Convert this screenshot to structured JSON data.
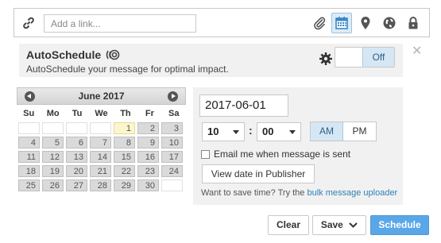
{
  "link_bar": {
    "placeholder": "Add a link..."
  },
  "autoschedule": {
    "title": "AutoSchedule",
    "description": "AutoSchedule your message for optimal impact.",
    "toggle_label": "Off"
  },
  "calendar": {
    "month_label": "June 2017",
    "weekdays": [
      "Su",
      "Mo",
      "Tu",
      "We",
      "Th",
      "Fr",
      "Sa"
    ],
    "days": [
      "",
      "",
      "",
      "",
      "1",
      "2",
      "3",
      "4",
      "5",
      "6",
      "7",
      "8",
      "9",
      "10",
      "11",
      "12",
      "13",
      "14",
      "15",
      "16",
      "17",
      "18",
      "19",
      "20",
      "21",
      "22",
      "23",
      "24",
      "25",
      "26",
      "27",
      "28",
      "29",
      "30",
      ""
    ],
    "today": "1",
    "selectable_days": []
  },
  "schedule": {
    "date": "2017-06-01",
    "hour": "10",
    "minute": "00",
    "colon": ":",
    "am_label": "AM",
    "pm_label": "PM",
    "email_label": "Email me when message is sent",
    "view_date_label": "View date in Publisher",
    "save_time_text": "Want to save time? Try the",
    "bulk_link_text": "bulk message uploader"
  },
  "footer": {
    "clear_label": "Clear",
    "save_label": "Save",
    "schedule_label": "Schedule"
  },
  "colors": {
    "accent": "#5aa7e8",
    "selected_toggle": "#d5e7f5",
    "link": "#2f7fb8"
  }
}
